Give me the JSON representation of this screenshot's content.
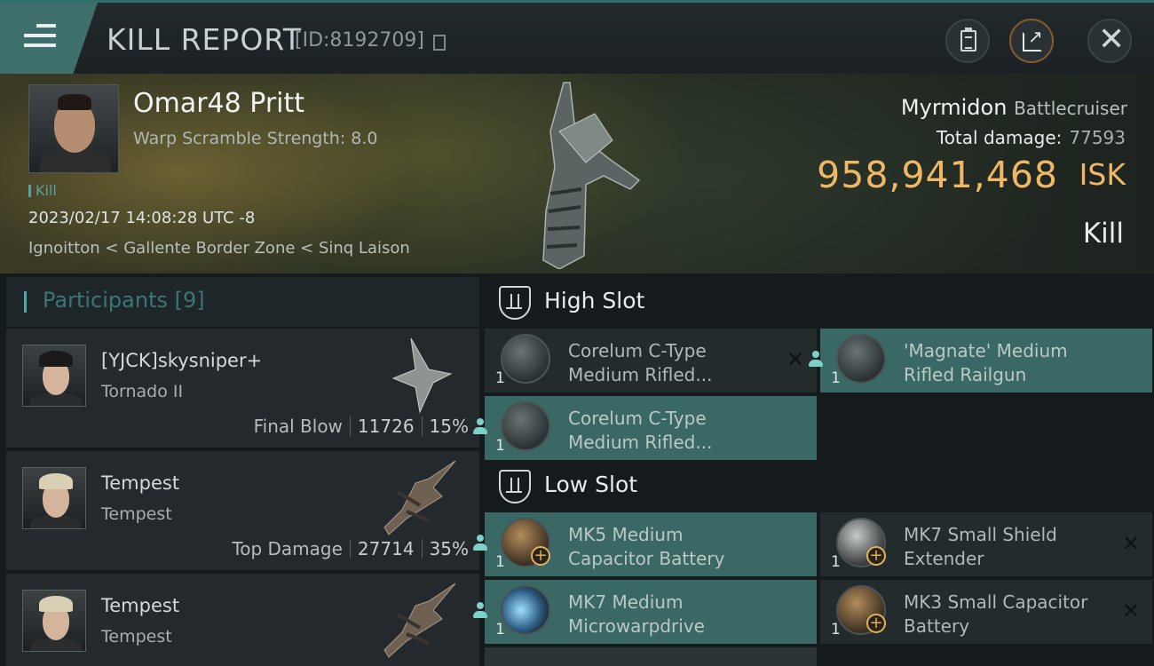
{
  "header": {
    "title": "KILL REPORT",
    "id_text": "[ID:8192709]"
  },
  "victim": {
    "name": "Omar48 Pritt",
    "warp_scramble": "Warp Scramble Strength: 8.0",
    "tag": "Kill",
    "datetime": "2023/02/17 14:08:28 UTC -8",
    "location": "Ignoitton < Gallente Border Zone < Sinq Laison"
  },
  "ship": {
    "name": "Myrmidon",
    "class": "Battlecruiser",
    "total_damage_label": "Total damage:",
    "total_damage": "77593",
    "isk_value": "958,941,468",
    "isk_unit": "ISK",
    "result": "Kill"
  },
  "participants": {
    "title": "Participants",
    "count": "[9]",
    "items": [
      {
        "name": "[YJCK]skysniper+",
        "ship": "Tornado II",
        "label": "Final Blow",
        "damage": "11726",
        "percent": "15%"
      },
      {
        "name": "Tempest",
        "ship": "Tempest",
        "label": "Top Damage",
        "damage": "27714",
        "percent": "35%"
      },
      {
        "name": "Tempest",
        "ship": "Tempest"
      }
    ]
  },
  "high_slot": {
    "title": "High Slot",
    "modules": [
      {
        "name": "Corelum C-Type Medium Rifled...",
        "qty": "1",
        "status": "destroyed",
        "icon": "turret-icon"
      },
      {
        "name": "'Magnate' Medium Rifled Railgun",
        "qty": "1",
        "status": "dropped",
        "icon": "turret-icon"
      },
      {
        "name": "Corelum C-Type Medium Rifled...",
        "qty": "1",
        "status": "dropped",
        "icon": "turret-icon"
      }
    ]
  },
  "low_slot": {
    "title": "Low Slot",
    "modules": [
      {
        "name": "MK5 Medium Capacitor Battery",
        "qty": "1",
        "status": "dropped",
        "icon": "battery-icon"
      },
      {
        "name": "MK7 Small Shield Extender",
        "qty": "1",
        "status": "destroyed",
        "icon": "shield-extender-icon"
      },
      {
        "name": "MK7 Medium Microwarpdrive",
        "qty": "1",
        "status": "dropped",
        "icon": "microwarpdrive-icon"
      },
      {
        "name": "MK3 Small Capacitor Battery",
        "qty": "1",
        "status": "destroyed",
        "icon": "battery-icon"
      }
    ]
  }
}
